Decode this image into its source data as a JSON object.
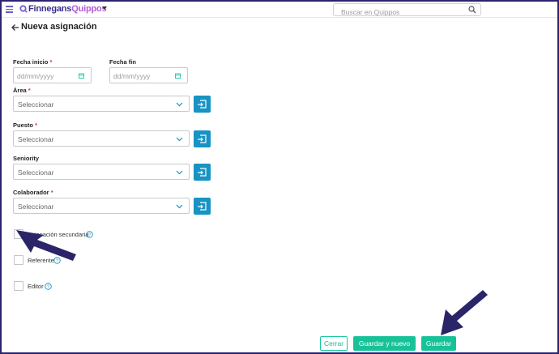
{
  "header": {
    "logo_part1": "Finnegans",
    "logo_part2": "Quippos",
    "search_placeholder": "Buscar en Quippos"
  },
  "page": {
    "title": "Nueva asignación"
  },
  "form": {
    "fecha_inicio_label": "Fecha inicio",
    "fecha_fin_label": "Fecha fin",
    "date_placeholder": "dd/mm/yyyy",
    "required_mark": "*",
    "area_label": "Área",
    "puesto_label": "Puesto",
    "seniority_label": "Seniority",
    "colaborador_label": "Colaborador",
    "select_placeholder": "Seleccionar",
    "checkboxes": [
      {
        "label": "Asignación secundaria",
        "checked": false
      },
      {
        "label": "Referente",
        "checked": false
      },
      {
        "label": "Editor",
        "checked": false
      }
    ]
  },
  "footer": {
    "close_label": "Cerrar",
    "save_new_label": "Guardar y nuevo",
    "save_label": "Guardar"
  },
  "colors": {
    "frame": "#2a2470",
    "accent_green": "#18c299",
    "accent_blue": "#1793c4",
    "brand_dark": "#3a2d8a",
    "brand_light": "#b15ad6",
    "arrow": "#2a2468"
  }
}
